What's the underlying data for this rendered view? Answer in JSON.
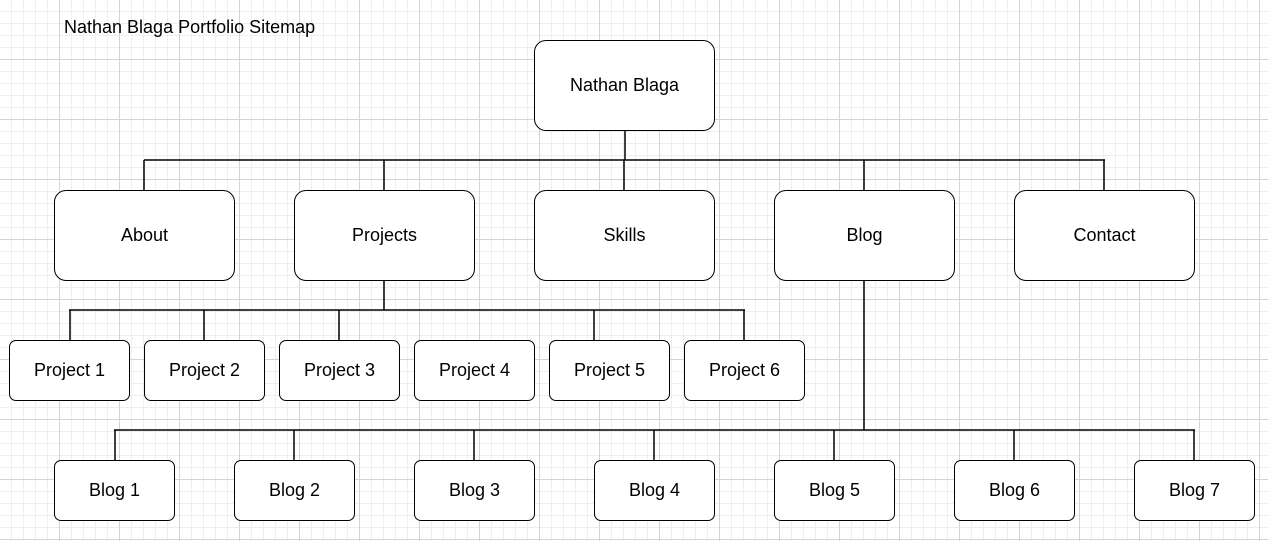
{
  "title": "Nathan Blaga Portfolio Sitemap",
  "colors": {
    "line": "#000000",
    "node_fill": "#ffffff",
    "grid_major": "#d4d4d4",
    "grid_minor": "#eeeeee"
  },
  "root": {
    "label": "Nathan Blaga"
  },
  "sections": [
    {
      "label": "About"
    },
    {
      "label": "Projects"
    },
    {
      "label": "Skills"
    },
    {
      "label": "Blog"
    },
    {
      "label": "Contact"
    }
  ],
  "projects": [
    {
      "label": "Project 1"
    },
    {
      "label": "Project 2"
    },
    {
      "label": "Project 3"
    },
    {
      "label": "Project 4"
    },
    {
      "label": "Project 5"
    },
    {
      "label": "Project 6"
    }
  ],
  "blogs": [
    {
      "label": "Blog 1"
    },
    {
      "label": "Blog 2"
    },
    {
      "label": "Blog 3"
    },
    {
      "label": "Blog 4"
    },
    {
      "label": "Blog 5"
    },
    {
      "label": "Blog 6"
    },
    {
      "label": "Blog 7"
    }
  ]
}
